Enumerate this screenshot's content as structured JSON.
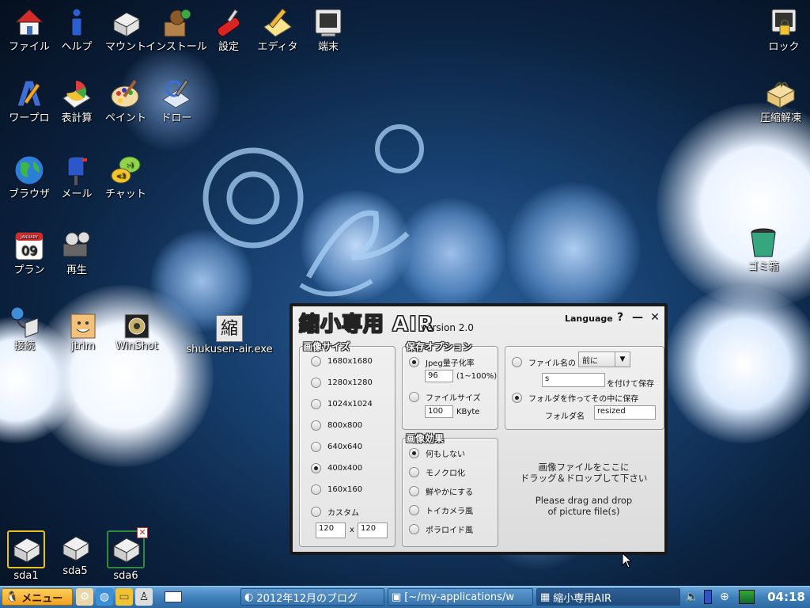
{
  "desktop": {
    "icons": [
      {
        "label": "ファイル"
      },
      {
        "label": "ヘルプ"
      },
      {
        "label": "マウント"
      },
      {
        "label": "インストール"
      },
      {
        "label": "設定"
      },
      {
        "label": "エディタ"
      },
      {
        "label": "端末"
      },
      {
        "label": "ワープロ"
      },
      {
        "label": "表計算"
      },
      {
        "label": "ペイント"
      },
      {
        "label": "ドロー"
      },
      {
        "label": "ブラウザ"
      },
      {
        "label": "メール"
      },
      {
        "label": "チャット"
      },
      {
        "label": "プラン"
      },
      {
        "label": "再生"
      },
      {
        "label": "接続"
      },
      {
        "label": "jtrim"
      },
      {
        "label": "WinShot"
      },
      {
        "label": "shukusen-air.exe"
      },
      {
        "label": "ロック"
      },
      {
        "label": "圧縮解凍"
      },
      {
        "label": "ゴミ箱"
      },
      {
        "label": "sda1"
      },
      {
        "label": "sda5"
      },
      {
        "label": "sda6"
      }
    ],
    "calendar_day": "09",
    "calendar_month": "JANUARY",
    "shukusen_glyph": "縮"
  },
  "app": {
    "title": "縮小専用 AIR",
    "version": "version 2.0",
    "language_label": "Language",
    "help_btn": "?",
    "minimize_btn": "—",
    "close_btn": "✕",
    "size_group": {
      "title": "画像サイズ",
      "options": [
        "1680x1680",
        "1280x1280",
        "1024x1024",
        "800x800",
        "640x640",
        "400x400",
        "160x160",
        "カスタム"
      ],
      "selected_index": 5,
      "custom_w": "120",
      "custom_x": "x",
      "custom_h": "120"
    },
    "save_group": {
      "title": "保存オプション",
      "jpeg_label": "Jpeg量子化率",
      "jpeg_value": "96",
      "jpeg_range": "(1~100%)",
      "filesize_label": "ファイルサイズ",
      "filesize_value": "100",
      "filesize_unit": "KByte",
      "selected": "jpeg"
    },
    "effect_group": {
      "title": "画像効果",
      "options": [
        "何もしない",
        "モノクロ化",
        "鮮やかにする",
        "トイカメラ風",
        "ポラロイド風"
      ],
      "selected_index": 0
    },
    "filename_group": {
      "filename_label": "ファイル名の",
      "position_value": "前に",
      "suffix_value": "s",
      "suffix_tail": "を付けて保存",
      "folder_option": "フォルダを作ってその中に保存",
      "folder_label": "フォルダ名",
      "folder_value": "resized",
      "selected": "folder"
    },
    "drop_jp_1": "画像ファイルをここに",
    "drop_jp_2": "ドラッグ＆ドロップして下さい",
    "drop_en_1": "Please drag and drop",
    "drop_en_2": "of picture file(s)"
  },
  "taskbar": {
    "menu_label": "メニュー",
    "tasks": [
      {
        "label": "2012年12月のブログ"
      },
      {
        "label": "[~/my-applications/w"
      },
      {
        "label": "縮小専用AIR"
      }
    ],
    "clock": "04:18"
  },
  "colors": {
    "taskbar": "#3f7fba",
    "accent_orange": "#f0a020"
  }
}
